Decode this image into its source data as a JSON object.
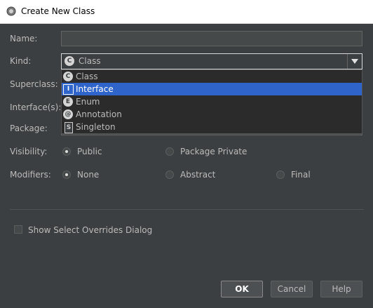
{
  "window": {
    "title": "Create New Class"
  },
  "form": {
    "name_label": "Name:",
    "name_value": "",
    "kind_label": "Kind:",
    "kind_selected": "Class",
    "superclass_label": "Superclass:",
    "interfaces_label": "Interface(s):",
    "package_label": "Package:",
    "visibility_label": "Visibility:",
    "modifiers_label": "Modifiers:"
  },
  "kind_options": [
    {
      "label": "Class",
      "icon": "class-icon",
      "badge": "C"
    },
    {
      "label": "Interface",
      "icon": "interface-icon",
      "badge": "I"
    },
    {
      "label": "Enum",
      "icon": "enum-icon",
      "badge": "E"
    },
    {
      "label": "Annotation",
      "icon": "annotation-icon",
      "badge": "@"
    },
    {
      "label": "Singleton",
      "icon": "singleton-icon",
      "badge": "S"
    }
  ],
  "kind_highlighted_index": 1,
  "visibility": {
    "options": [
      "Public",
      "Package Private"
    ],
    "selected": "Public"
  },
  "modifiers": {
    "options": [
      "None",
      "Abstract",
      "Final"
    ],
    "selected": "None"
  },
  "options": {
    "show_overrides_label": "Show Select Overrides Dialog",
    "show_overrides_checked": false
  },
  "buttons": {
    "ok": "OK",
    "cancel": "Cancel",
    "help": "Help"
  },
  "colors": {
    "accent": "#2f65ca",
    "background": "#3c3f41",
    "text": "#bbbbbb"
  }
}
